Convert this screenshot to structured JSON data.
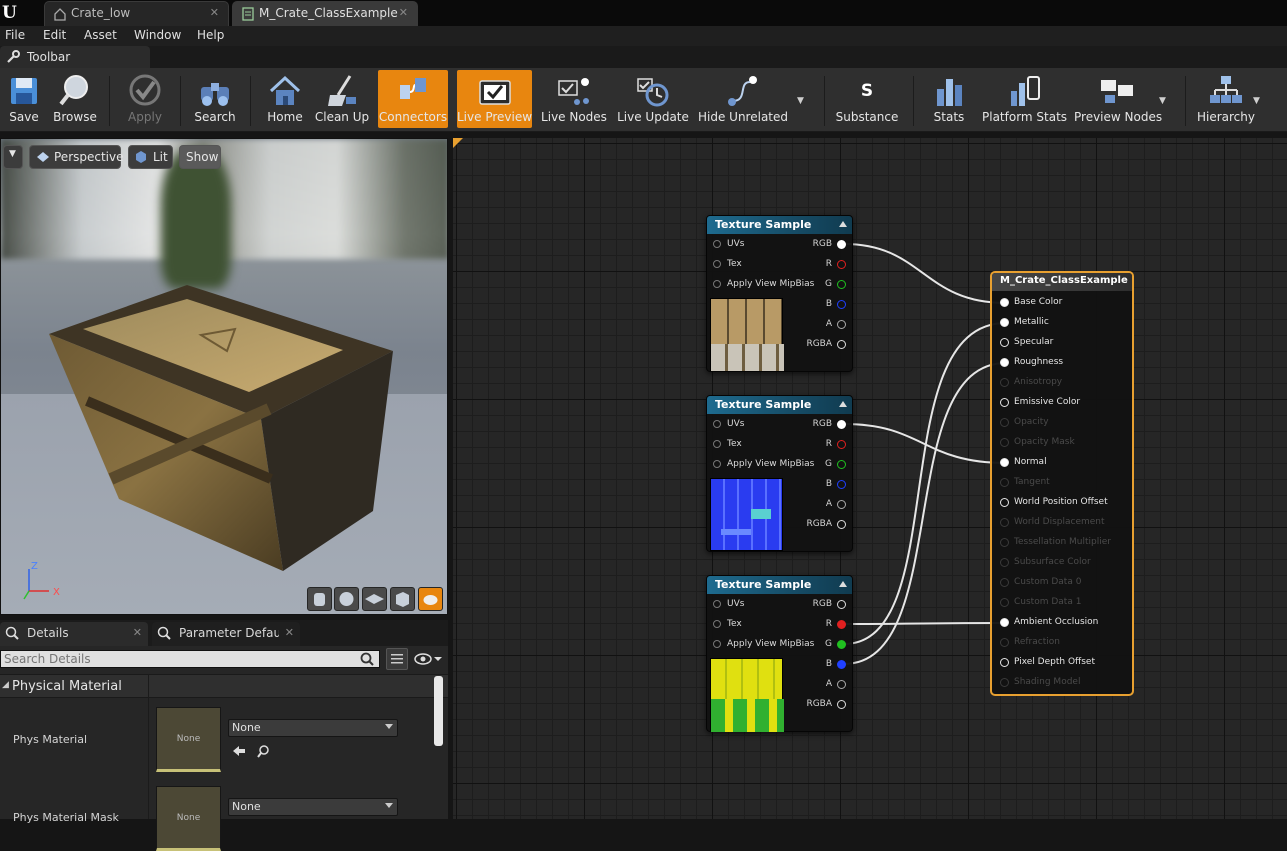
{
  "tabs": [
    {
      "label": "Crate_low",
      "active": false
    },
    {
      "label": "M_Crate_ClassExample",
      "active": true
    }
  ],
  "menu": [
    "File",
    "Edit",
    "Asset",
    "Window",
    "Help"
  ],
  "toolbar_tab": {
    "label": "Toolbar"
  },
  "toolbar": {
    "save": "Save",
    "browse": "Browse",
    "apply": "Apply",
    "search": "Search",
    "home": "Home",
    "cleanup": "Clean Up",
    "connectors": "Connectors",
    "livepreview": "Live Preview",
    "livenodes": "Live Nodes",
    "liveupdate": "Live Update",
    "hideunrelated": "Hide Unrelated",
    "substance": "Substance",
    "stats": "Stats",
    "platformstats": "Platform Stats",
    "previewnodes": "Preview Nodes",
    "hierarchy": "Hierarchy"
  },
  "viewport": {
    "perspective": "Perspective",
    "lit": "Lit",
    "show": "Show",
    "axis_z": "Z",
    "axis_x": "X"
  },
  "details": {
    "tab_details": "Details",
    "tab_params": "Parameter Defaults",
    "search_placeholder": "Search Details",
    "section": "Physical Material",
    "props": [
      {
        "label": "Phys Material",
        "thumb": "None",
        "value": "None"
      },
      {
        "label": "Phys Material Mask",
        "thumb": "None",
        "value": "None"
      }
    ]
  },
  "nodes": [
    {
      "title": "Texture Sample",
      "inputs": [
        "UVs",
        "Tex",
        "Apply View MipBias"
      ],
      "outputs": [
        "RGB",
        "R",
        "G",
        "B",
        "A",
        "RGBA"
      ]
    },
    {
      "title": "Texture Sample",
      "inputs": [
        "UVs",
        "Tex",
        "Apply View MipBias"
      ],
      "outputs": [
        "RGB",
        "R",
        "G",
        "B",
        "A",
        "RGBA"
      ]
    },
    {
      "title": "Texture Sample",
      "inputs": [
        "UVs",
        "Tex",
        "Apply View MipBias"
      ],
      "outputs": [
        "RGB",
        "R",
        "G",
        "B",
        "A",
        "RGBA"
      ]
    }
  ],
  "master": {
    "title": "M_Crate_ClassExample",
    "pins": [
      {
        "label": "Base Color",
        "enabled": true,
        "connected": true
      },
      {
        "label": "Metallic",
        "enabled": true,
        "connected": true
      },
      {
        "label": "Specular",
        "enabled": true,
        "connected": false
      },
      {
        "label": "Roughness",
        "enabled": true,
        "connected": true
      },
      {
        "label": "Anisotropy",
        "enabled": false,
        "connected": false
      },
      {
        "label": "Emissive Color",
        "enabled": true,
        "connected": false
      },
      {
        "label": "Opacity",
        "enabled": false,
        "connected": false
      },
      {
        "label": "Opacity Mask",
        "enabled": false,
        "connected": false
      },
      {
        "label": "Normal",
        "enabled": true,
        "connected": true
      },
      {
        "label": "Tangent",
        "enabled": false,
        "connected": false
      },
      {
        "label": "World Position Offset",
        "enabled": true,
        "connected": false
      },
      {
        "label": "World Displacement",
        "enabled": false,
        "connected": false
      },
      {
        "label": "Tessellation Multiplier",
        "enabled": false,
        "connected": false
      },
      {
        "label": "Subsurface Color",
        "enabled": false,
        "connected": false
      },
      {
        "label": "Custom Data 0",
        "enabled": false,
        "connected": false
      },
      {
        "label": "Custom Data 1",
        "enabled": false,
        "connected": false
      },
      {
        "label": "Ambient Occlusion",
        "enabled": true,
        "connected": true
      },
      {
        "label": "Refraction",
        "enabled": false,
        "connected": false
      },
      {
        "label": "Pixel Depth Offset",
        "enabled": true,
        "connected": false
      },
      {
        "label": "Shading Model",
        "enabled": false,
        "connected": false
      }
    ]
  },
  "colors": {
    "accent": "#e8860f",
    "master_border": "#e8a030",
    "node_header": "#1e6b8f",
    "pin_r": "#e02020",
    "pin_g": "#20c020",
    "pin_b": "#2040ff"
  },
  "icons": [
    "ue-logo",
    "level-icon",
    "material-icon",
    "wrench-icon",
    "save-icon",
    "browse-icon",
    "apply-icon",
    "search-icon",
    "home-icon",
    "cleanup-icon",
    "connectors-icon",
    "live-preview-icon",
    "live-nodes-icon",
    "live-update-icon",
    "hide-unrelated-icon",
    "substance-icon",
    "stats-icon",
    "platform-stats-icon",
    "preview-nodes-icon",
    "hierarchy-icon"
  ]
}
